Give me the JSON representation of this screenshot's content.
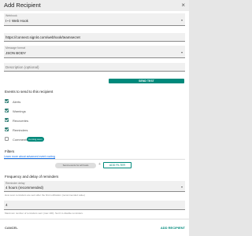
{
  "dialog": {
    "title": "Add Recipient",
    "close_glyph": "×"
  },
  "webhook": {
    "label": "Webhook",
    "value": "Web Hook",
    "icon": "webhook-icon",
    "caret": "▾"
  },
  "url": {
    "value": "https://connect.signl4.com/webhook/teamsecret"
  },
  "message_format": {
    "label": "Message format",
    "value": "JSON BODY",
    "caret": "▾"
  },
  "description": {
    "placeholder": "Description (optional)"
  },
  "send_test": "SEND TEST",
  "events": {
    "heading": "Events to send to this recipient",
    "items": [
      {
        "label": "Alerts",
        "checked": true
      },
      {
        "label": "Warnings",
        "checked": true
      },
      {
        "label": "Recoveries",
        "checked": true
      },
      {
        "label": "Reminders",
        "checked": true
      },
      {
        "label": "Comments",
        "checked": false,
        "badge": "Coming soon"
      }
    ]
  },
  "filters": {
    "heading": "Filters",
    "link": "Learn more about advanced event routing",
    "chip": "Send events for all hosts",
    "separator": "+",
    "add_filter": "ADD FILTER"
  },
  "frequency": {
    "heading": "Frequency and delay of reminders",
    "reminder_label": "Reminder delay",
    "reminder_value": "4 hours (recommended)",
    "caret": "▾",
    "reminder_hint": "How soon reminders are sent after the first notification (recommended value)",
    "count_value": "4",
    "count_hint": "Maximum number of reminders sent (max 100). Set 0 to disable reminders."
  },
  "footer": {
    "cancel": "CANCEL",
    "add": "ADD RECIPIENT"
  },
  "colors": {
    "accent": "#00897b",
    "check": "#2e7d73"
  }
}
